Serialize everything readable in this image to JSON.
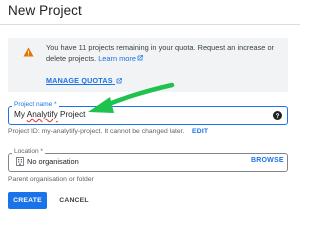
{
  "page": {
    "title": "New Project"
  },
  "quota": {
    "icon": "warning-icon",
    "warning_color": "#e37400",
    "text_before": "You have 11 projects remaining in your quota. Request an increase or delete projects.",
    "learn_more": "Learn more",
    "manage_quotas": "MANAGE QUOTAS"
  },
  "project_name": {
    "label": "Project name *",
    "value_prefix": "My ",
    "value_misspelled": "Analytify",
    "value_suffix": " Project",
    "help_icon": "help-icon"
  },
  "project_id": {
    "text": "Project ID: my-analytify-project. It cannot be changed later.",
    "edit": "EDIT"
  },
  "location": {
    "label": "Location *",
    "value": "No organisation",
    "icon": "organization-icon",
    "browse": "BROWSE",
    "helper": "Parent organisation or folder"
  },
  "actions": {
    "create": "CREATE",
    "cancel": "CANCEL"
  },
  "annotation": {
    "arrow_color": "#1fc24f"
  },
  "colors": {
    "accent": "#1a73e8"
  }
}
